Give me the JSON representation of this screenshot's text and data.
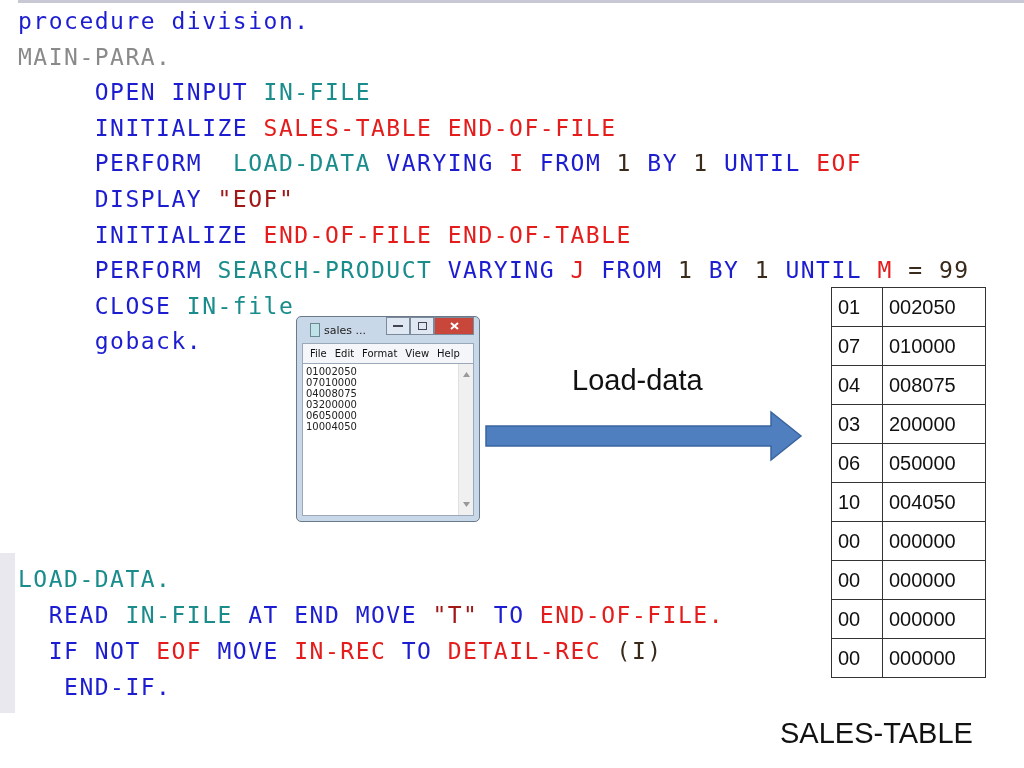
{
  "code_main": {
    "lines": [
      {
        "tokens": [
          {
            "t": "procedure division.",
            "kind": "kw"
          }
        ]
      },
      {
        "tokens": [
          {
            "t": "MAIN-PARA.",
            "kind": "label"
          }
        ]
      },
      {
        "tokens": [
          {
            "t": "     OPEN INPUT ",
            "kind": "kw"
          },
          {
            "t": "IN-FILE",
            "kind": "id"
          }
        ]
      },
      {
        "tokens": [
          {
            "t": "     INITIALIZE ",
            "kind": "kw"
          },
          {
            "t": "SALES-TABLE END-OF-FILE",
            "kind": "var"
          }
        ]
      },
      {
        "tokens": [
          {
            "t": "     PERFORM  ",
            "kind": "kw"
          },
          {
            "t": "LOAD-DATA ",
            "kind": "id"
          },
          {
            "t": "VARYING ",
            "kind": "kw"
          },
          {
            "t": "I ",
            "kind": "var"
          },
          {
            "t": "FROM ",
            "kind": "kw"
          },
          {
            "t": "1 ",
            "kind": "num"
          },
          {
            "t": "BY ",
            "kind": "kw"
          },
          {
            "t": "1 ",
            "kind": "num"
          },
          {
            "t": "UNTIL ",
            "kind": "kw"
          },
          {
            "t": "EOF",
            "kind": "var"
          }
        ]
      },
      {
        "tokens": [
          {
            "t": "     DISPLAY ",
            "kind": "kw"
          },
          {
            "t": "\"EOF\"",
            "kind": "str"
          }
        ]
      },
      {
        "tokens": [
          {
            "t": "     INITIALIZE ",
            "kind": "kw"
          },
          {
            "t": "END-OF-FILE END-OF-TABLE",
            "kind": "var"
          }
        ]
      },
      {
        "tokens": [
          {
            "t": "     PERFORM ",
            "kind": "kw"
          },
          {
            "t": "SEARCH-PRODUCT ",
            "kind": "id"
          },
          {
            "t": "VARYING ",
            "kind": "kw"
          },
          {
            "t": "J ",
            "kind": "var"
          },
          {
            "t": "FROM ",
            "kind": "kw"
          },
          {
            "t": "1 ",
            "kind": "num"
          },
          {
            "t": "BY ",
            "kind": "kw"
          },
          {
            "t": "1 ",
            "kind": "num"
          },
          {
            "t": "UNTIL ",
            "kind": "kw"
          },
          {
            "t": "M ",
            "kind": "var"
          },
          {
            "t": "= 99",
            "kind": "num"
          }
        ]
      },
      {
        "tokens": [
          {
            "t": "     CLOSE ",
            "kind": "kw"
          },
          {
            "t": "IN-file",
            "kind": "id"
          }
        ]
      },
      {
        "tokens": [
          {
            "t": "     goback.",
            "kind": "kw"
          }
        ]
      }
    ]
  },
  "notepad": {
    "title": "sales ...",
    "menu": [
      "File",
      "Edit",
      "Format",
      "View",
      "Help"
    ],
    "lines": [
      "01002050",
      "07010000",
      "04008075",
      "03200000",
      "06050000",
      "10004050"
    ]
  },
  "arrow_label": "Load-data",
  "sales_table": {
    "rows": [
      [
        "01",
        "002050"
      ],
      [
        "07",
        "010000"
      ],
      [
        "04",
        "008075"
      ],
      [
        "03",
        "200000"
      ],
      [
        "06",
        "050000"
      ],
      [
        "10",
        "004050"
      ],
      [
        "00",
        "000000"
      ],
      [
        "00",
        "000000"
      ],
      [
        "00",
        "000000"
      ],
      [
        "00",
        "000000"
      ]
    ]
  },
  "caption": "SALES-TABLE",
  "code_load": {
    "lines": [
      {
        "tokens": [
          {
            "t": "LOAD-DATA.",
            "kind": "id"
          }
        ]
      },
      {
        "tokens": [
          {
            "t": "  READ ",
            "kind": "kw"
          },
          {
            "t": "IN-FILE ",
            "kind": "id"
          },
          {
            "t": "AT END MOVE ",
            "kind": "kw"
          },
          {
            "t": "\"T\" ",
            "kind": "str"
          },
          {
            "t": "TO ",
            "kind": "kw"
          },
          {
            "t": "END-OF-FILE.",
            "kind": "var"
          }
        ]
      },
      {
        "tokens": [
          {
            "t": "  IF NOT ",
            "kind": "kw"
          },
          {
            "t": "EOF ",
            "kind": "var"
          },
          {
            "t": "MOVE ",
            "kind": "kw"
          },
          {
            "t": "IN-REC ",
            "kind": "var"
          },
          {
            "t": "TO ",
            "kind": "kw"
          },
          {
            "t": "DETAIL-REC ",
            "kind": "var"
          },
          {
            "t": "(I)",
            "kind": "num"
          }
        ]
      },
      {
        "tokens": [
          {
            "t": "   END-IF.",
            "kind": "kw"
          }
        ]
      }
    ]
  }
}
